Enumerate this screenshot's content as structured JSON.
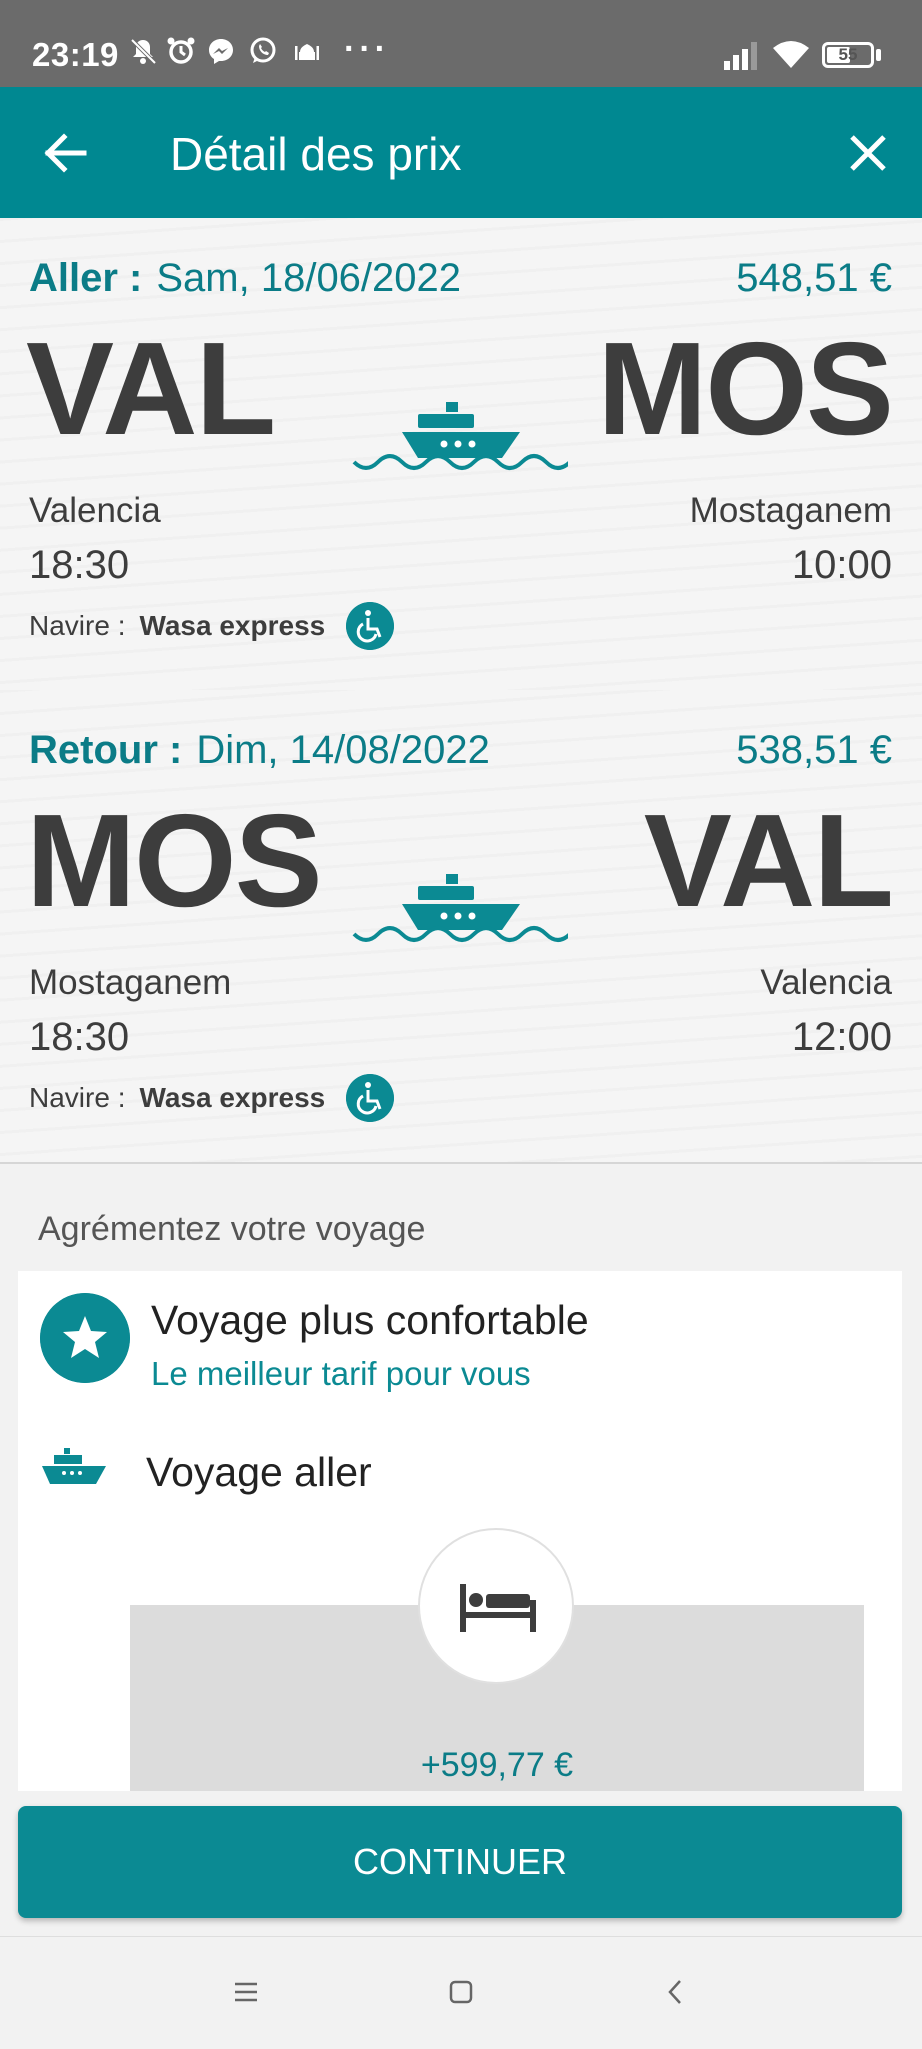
{
  "status_bar": {
    "time": "23:19",
    "more": "···",
    "battery": "55",
    "icons": [
      "bell-off-icon",
      "alarm-icon",
      "messenger-icon",
      "whatsapp-icon",
      "mosque-icon",
      "signal-icon",
      "wifi-icon",
      "battery-icon"
    ]
  },
  "header": {
    "title": "Détail des prix",
    "back_icon": "arrow-left-icon",
    "close_icon": "close-icon"
  },
  "trips": [
    {
      "label": "Aller :",
      "date": "Sam, 18/06/2022",
      "price": "548,51 €",
      "from_code": "VAL",
      "to_code": "MOS",
      "from_city": "Valencia",
      "to_city": "Mostaganem",
      "depart_time": "18:30",
      "arrive_time": "10:00",
      "vessel_label": "Navire :",
      "vessel_name": "Wasa express"
    },
    {
      "label": "Retour :",
      "date": "Dim, 14/08/2022",
      "price": "538,51 €",
      "from_code": "MOS",
      "to_code": "VAL",
      "from_city": "Mostaganem",
      "to_city": "Valencia",
      "depart_time": "18:30",
      "arrive_time": "12:00",
      "vessel_label": "Navire :",
      "vessel_name": "Wasa express"
    }
  ],
  "extras": {
    "section_title": "Agrémentez votre voyage",
    "offer_title": "Voyage plus confortable",
    "offer_subtitle": "Le meilleur tarif pour vous",
    "outbound_label": "Voyage aller",
    "cabin_price": "+599,77 €"
  },
  "footer": {
    "continue_label": "CONTINUER"
  },
  "colors": {
    "accent": "#008891",
    "teal_text": "#0b7c87",
    "code_text": "#3d3d3d",
    "status_bar": "#6b6b6b"
  },
  "battery_level": 0.55
}
